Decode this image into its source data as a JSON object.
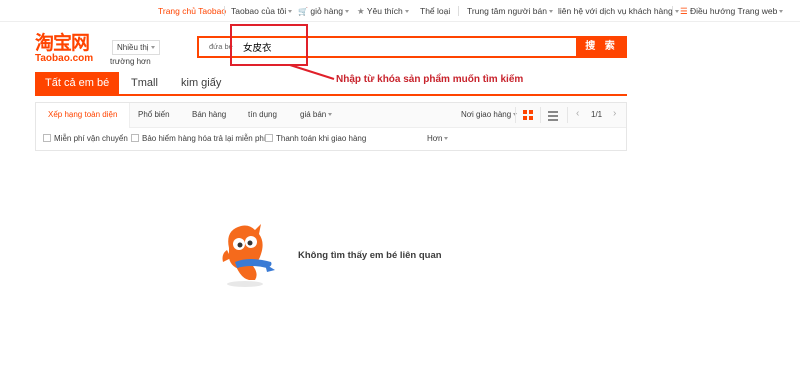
{
  "topbar": {
    "home": "Trang chủ Taobao",
    "my_taobao": "Taobao của tôi",
    "cart": "giỏ hàng",
    "favorites": "Yêu thích",
    "category": "Thể loại",
    "seller_center": "Trung tâm người bán",
    "contact_service": "liên hệ với dịch vụ khách hàng",
    "site_nav": "Điều hướng Trang web"
  },
  "header": {
    "logo_cn": "淘宝网",
    "logo_en": "Taobao.com",
    "region_select": "Nhiều thị",
    "region_sub": "trường hơn"
  },
  "search": {
    "type_label": "đứa bé",
    "value": "女皮衣",
    "button_label": "搜 索"
  },
  "annotation": {
    "text": "Nhập từ khóa sản phẩm muốn tìm kiếm",
    "color": "#e0202a"
  },
  "tabs": [
    {
      "label": "Tất cả em bé",
      "active": true
    },
    {
      "label": "Tmall",
      "active": false
    },
    {
      "label": "kim giấy",
      "active": false
    }
  ],
  "sort": {
    "items": [
      "Xếp hạng toàn diện",
      "Phổ biến",
      "Bán hàng",
      "tín dụng",
      "giá bán"
    ],
    "location": "Nơi giao hàng",
    "page": "1/1"
  },
  "filters": {
    "free_shipping": "Miễn phí vận chuyển",
    "return_insurance": "Bảo hiểm hàng hóa trả lại miễn phí",
    "cod": "Thanh toán khi giao hàng",
    "more": "Hơn"
  },
  "empty": {
    "message": "Không tìm thấy em bé liên quan"
  },
  "colors": {
    "brand": "#ff4400",
    "annotation": "#e0202a"
  }
}
